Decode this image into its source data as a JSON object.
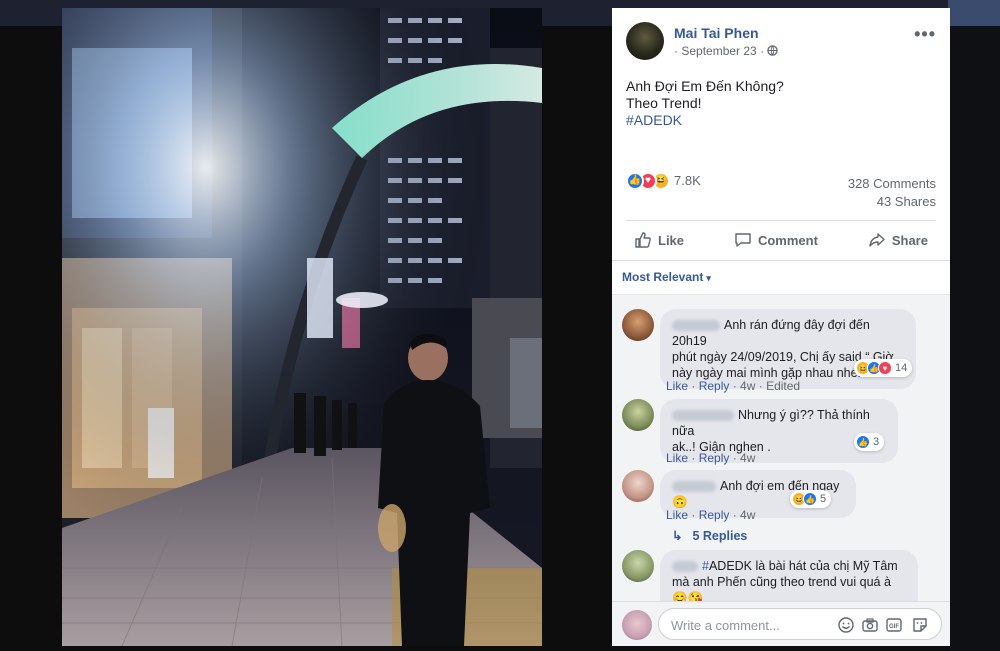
{
  "post": {
    "author": "Mai Tai Phen",
    "date": "September 23",
    "date_separator": " · ",
    "privacy_icon": "globe-icon",
    "more_label": "•••",
    "caption_lines": [
      "Anh Đợi Em Đến Không?",
      "Theo Trend!"
    ],
    "hashtag": "#ADEDK",
    "reactions": {
      "count": "7.8K",
      "types": [
        "like",
        "love",
        "haha"
      ],
      "comments": "328 Comments",
      "shares": "43 Shares"
    },
    "actions": {
      "like": "Like",
      "comment": "Comment",
      "share": "Share"
    },
    "sort_label": "Most Relevant",
    "sort_caret": "▾"
  },
  "comments": [
    {
      "text_line1": "Anh rán đứng đây đợi đến 20h19",
      "text_line2": "phút ngày 24/09/2019, Chị ấy said “ Giờ",
      "text_line3": "này ngày mai mình gặp nhau nhé!”",
      "like": "Like",
      "reply": "Reply",
      "time": "4w",
      "edited": "Edited",
      "reaction_count": "14"
    },
    {
      "text_line1": "Nhưng ý gì?? Thả thính nữa",
      "text_line2": "ak..! Giận nghen .",
      "like": "Like",
      "reply": "Reply",
      "time": "4w",
      "reaction_count": "3"
    },
    {
      "text_line1": "Anh đợi em đến ngay 🙃",
      "like": "Like",
      "reply": "Reply",
      "time": "4w",
      "reaction_count": "5"
    },
    {
      "text_line1": "ADEDK là bài hát của chị Mỹ Tâm",
      "text_line2": "mà anh Phến cũng theo trend vui quá à",
      "text_line3": "😊😘",
      "hashtag_prefix": "#"
    }
  ],
  "replies_label": "5 Replies",
  "replies_arrow": "↳",
  "composer": {
    "placeholder": "Write a comment...",
    "tools": [
      "emoji-icon",
      "camera-icon",
      "gif-icon",
      "sticker-icon"
    ]
  },
  "colors": {
    "link": "#385898",
    "like_blue": "#1877f2",
    "love_red": "#f33e58",
    "haha_yellow": "#f7b125"
  }
}
